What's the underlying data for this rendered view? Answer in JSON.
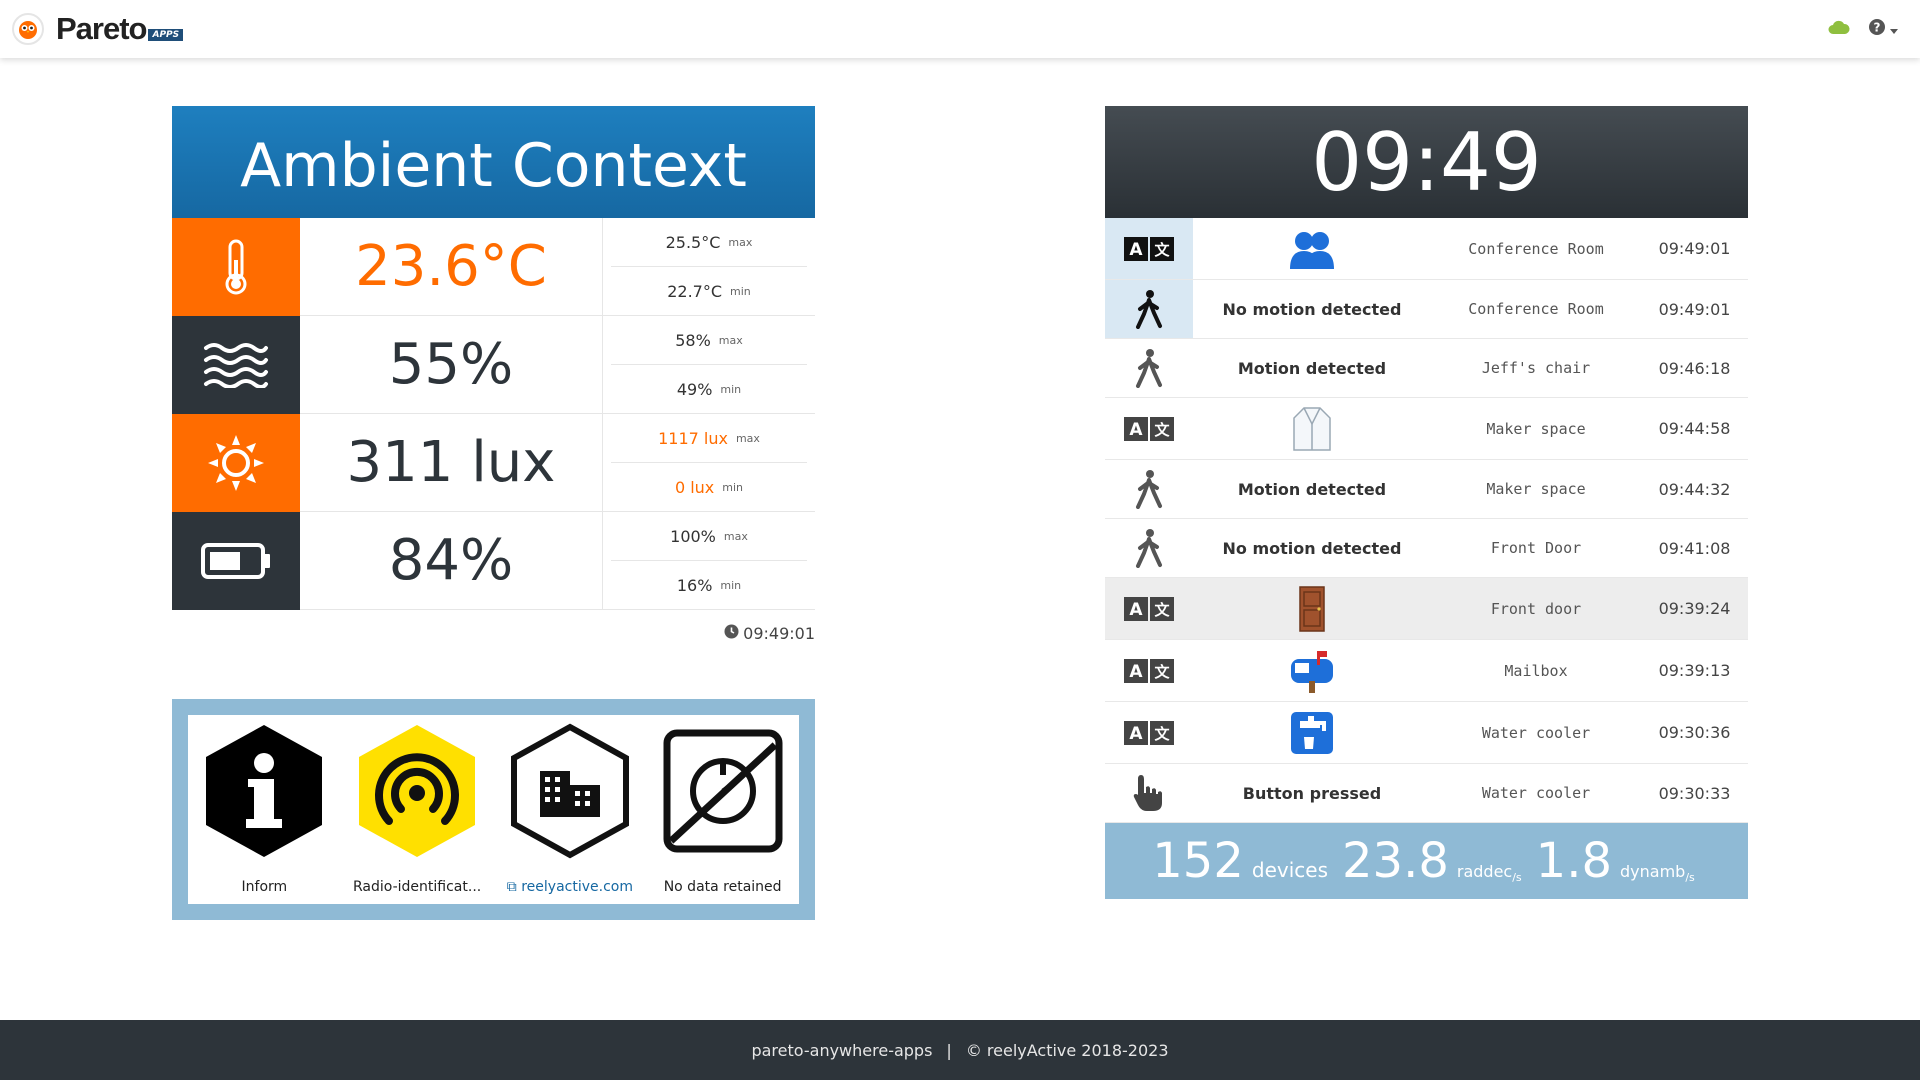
{
  "navbar": {
    "brand": "Pareto",
    "brand_tag": "APPS",
    "logo_icon": "owl-logo-icon",
    "cloud_icon": "cloud-icon",
    "help_icon": "question-circle-icon",
    "cloud_color": "#8fbf3f"
  },
  "ambient": {
    "title": "Ambient Context",
    "timestamp": "09:49:01",
    "rows": [
      {
        "icon": "thermometer-icon",
        "value": "23.6°C",
        "max": "25.5°C",
        "max_label": "max",
        "min": "22.7°C",
        "min_label": "min"
      },
      {
        "icon": "humidity-waves-icon",
        "value": "55%",
        "max": "58%",
        "max_label": "max",
        "min": "49%",
        "min_label": "min"
      },
      {
        "icon": "sun-icon",
        "value": "311 lux",
        "max": "1117 lux",
        "max_label": "max",
        "min": "0 lux",
        "min_label": "min"
      },
      {
        "icon": "battery-icon",
        "value": "84%",
        "max": "100%",
        "max_label": "max",
        "min": "16%",
        "min_label": "min"
      }
    ]
  },
  "info": {
    "items": [
      {
        "label": "Inform",
        "icon": "info-hexagon-icon"
      },
      {
        "label": "Radio-identificat...",
        "icon": "radio-signal-hexagon-icon"
      },
      {
        "label": "reelyactive.com",
        "icon": "building-hexagon-icon"
      },
      {
        "label": "No data retained",
        "icon": "no-data-retained-icon"
      }
    ]
  },
  "feed": {
    "clock": "09:49",
    "rows": [
      {
        "icon": "translate-icon",
        "main_emoji": "👥",
        "main": "",
        "location": "Conference Room",
        "time": "09:49:01"
      },
      {
        "icon": "walking-person-icon",
        "main": "No motion detected",
        "location": "Conference Room",
        "time": "09:49:01"
      },
      {
        "icon": "walking-person-icon",
        "main": "Motion detected",
        "location": "Jeff's chair",
        "time": "09:46:18"
      },
      {
        "icon": "translate-icon",
        "main_emoji": "🥼",
        "main": "",
        "location": "Maker space",
        "time": "09:44:58"
      },
      {
        "icon": "walking-person-icon",
        "main": "Motion detected",
        "location": "Maker space",
        "time": "09:44:32"
      },
      {
        "icon": "walking-person-icon",
        "main": "No motion detected",
        "location": "Front Door",
        "time": "09:41:08"
      },
      {
        "icon": "translate-icon",
        "main_emoji": "🚪",
        "main": "",
        "location": "Front door",
        "time": "09:39:24"
      },
      {
        "icon": "translate-icon",
        "main_emoji": "📬",
        "main": "",
        "location": "Mailbox",
        "time": "09:39:13"
      },
      {
        "icon": "translate-icon",
        "main_emoji": "🚰",
        "main": "",
        "location": "Water cooler",
        "time": "09:30:36"
      },
      {
        "icon": "pointing-hand-icon",
        "main": "Button pressed",
        "location": "Water cooler",
        "time": "09:30:33"
      }
    ],
    "stats": {
      "devices": "152",
      "devices_label": "devices",
      "raddec": "23.8",
      "raddec_label": "raddec",
      "raddec_sub": "/s",
      "dynamb": "1.8",
      "dynamb_label": "dynamb",
      "dynamb_sub": "/s"
    }
  },
  "footer": {
    "left": "pareto-anywhere-apps",
    "separator": "|",
    "right": "© reelyActive 2018-2023"
  },
  "colors": {
    "orange": "#ff6c00",
    "dark": "#2d343a",
    "blue_header": "#1668a2",
    "light_blue": "#8fbad5",
    "yellow": "#ffe000"
  }
}
